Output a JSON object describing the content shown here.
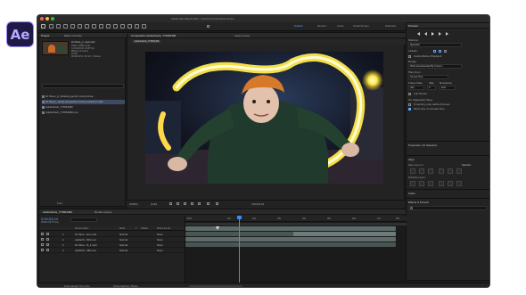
{
  "app_logo": "Ae",
  "window_title": "Adobe After Effects 2024 - /Users/yourname/Documents/...",
  "workspaces": [
    "Default",
    "Review",
    "Learn",
    "Small Screen",
    "Standard",
    "Libraries"
  ],
  "active_workspace": "Default",
  "search_help_placeholder": "Search Help",
  "project_panel": {
    "tab": "Project",
    "tab2": "Effect Controls",
    "thumb_info": [
      "10 Street_yt...layer.mp4",
      "1920 x 1080 (1.00)",
      "Δ 0;00;09;20, 29.97 fps",
      "Millions of Colors",
      "H.264",
      "48.000 kHz / 32 bit U / Stereo"
    ],
    "items": [
      {
        "name": "10 Street_yt_Relaxing gently moving forwa...",
        "selected": false
      },
      {
        "name": "10 Street_ slowly and gently moving forward at night",
        "selected": true
      },
      {
        "name": "AdobeStock_773664496",
        "selected": false
      },
      {
        "name": "AdobeStock_773664496.mov",
        "selected": false
      }
    ],
    "footer": "8 bpc"
  },
  "composition_panel": {
    "tab": "Composition AdobeStock_773664496",
    "layer_tab": "Layer (none)",
    "subtab": "AdobeStock_773664496",
    "zoom": "(100%)",
    "resolution": "(Full)",
    "timecode": "0;00;03;13"
  },
  "right_panel": {
    "tab": "Preview",
    "shortcut_label": "Shortcut",
    "shortcut_value": "Spacebar",
    "include_label": "Include:",
    "cache_before": "Cache Before Playback",
    "range_label": "Range",
    "range_value": "Work Area Extended By Current...",
    "play_from_label": "Play From",
    "play_from_value": "Current Time",
    "frame_rate_label": "Frame Rate",
    "skip_label": "Skip",
    "resolution_label": "Resolution",
    "frame_rate_value": "(30)",
    "skip_value": "0",
    "resolution_value": "Auto",
    "full_screen": "Full Screen",
    "on_stop_label": "On (Spacebar) Stop:",
    "if_caching": "If caching, play cached frames",
    "move_time": "Move time to preview time",
    "properties": "Properties: No Selection",
    "align": "Align",
    "align_layers_to": "Align Layers to:",
    "align_to_value": "Selection",
    "distribute_layers": "Distribute Layers:",
    "audio": "Audio",
    "effects_presets": "Effects & Presets"
  },
  "timeline": {
    "tab": "AdobeStock_773664496",
    "tab2": "Render Queue",
    "timecode": "0;00;03;13",
    "frames": "00103 (29.97 fps)",
    "columns": [
      "Source Name",
      "Mode",
      "T",
      "TrkMat",
      "Parent & Link"
    ],
    "layers": [
      {
        "num": "1",
        "name": "10 Stree...ture.mp4",
        "mode": "Normal",
        "parent": "None"
      },
      {
        "num": "2",
        "name": "AdobeSt...664.mov",
        "mode": "Normal",
        "parent": "None"
      },
      {
        "num": "3",
        "name": "10 Stree...ht_1.mp4",
        "mode": "Normal",
        "parent": "None"
      },
      {
        "num": "4",
        "name": "AdobeSt...496.mov",
        "mode": "Normal",
        "parent": "None"
      }
    ],
    "ruler": [
      "0;00f",
      "01s",
      "02s",
      "03s",
      "04s",
      "05s",
      "06s",
      "07s",
      "08s",
      "09s"
    ],
    "playhead_seconds": 3.43
  },
  "status": {
    "frame_render_time": "Frame Render Time: 0ms",
    "toggle": "Toggle Switches / Modes"
  },
  "colors": {
    "accent": "#5aa4ff",
    "layer_bar": "#5c6a6a",
    "layer_bar_alt": "#4a5654",
    "logo_bg": "#1f1a45",
    "logo_text": "#b8a8ff"
  }
}
